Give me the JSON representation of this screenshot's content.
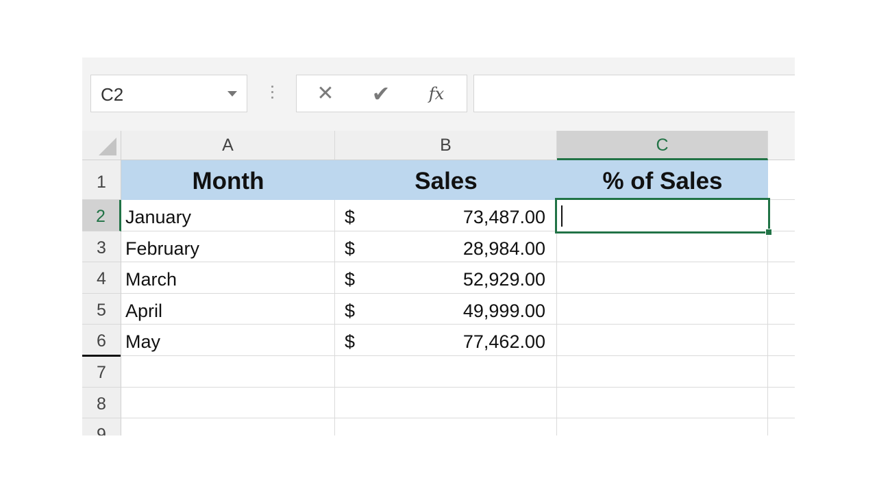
{
  "name_box": {
    "value": "C2"
  },
  "formula_bar": {
    "cancel_glyph": "✕",
    "enter_glyph": "✔",
    "fx_label": "fx",
    "value": ""
  },
  "columns": [
    {
      "label": "A",
      "selected": false
    },
    {
      "label": "B",
      "selected": false
    },
    {
      "label": "C",
      "selected": true
    }
  ],
  "rows": [
    {
      "num": "1",
      "a": "Month",
      "b_currency": "",
      "b_amount": "Sales",
      "c": "% of Sales",
      "header": true
    },
    {
      "num": "2",
      "a": "January",
      "b_currency": "$",
      "b_amount": "73,487.00",
      "c": ""
    },
    {
      "num": "3",
      "a": "February",
      "b_currency": "$",
      "b_amount": "28,984.00",
      "c": ""
    },
    {
      "num": "4",
      "a": "March",
      "b_currency": "$",
      "b_amount": "52,929.00",
      "c": ""
    },
    {
      "num": "5",
      "a": "April",
      "b_currency": "$",
      "b_amount": "49,999.00",
      "c": ""
    },
    {
      "num": "6",
      "a": "May",
      "b_currency": "$",
      "b_amount": "77,462.00",
      "c": ""
    },
    {
      "num": "7",
      "a": "",
      "b_currency": "",
      "b_amount": "",
      "c": ""
    },
    {
      "num": "8",
      "a": "",
      "b_currency": "",
      "b_amount": "",
      "c": ""
    },
    {
      "num": "9",
      "a": "",
      "b_currency": "",
      "b_amount": "",
      "c": ""
    }
  ],
  "active_cell": "C2",
  "colors": {
    "accent": "#217346",
    "header_fill": "#BDD7EE"
  }
}
